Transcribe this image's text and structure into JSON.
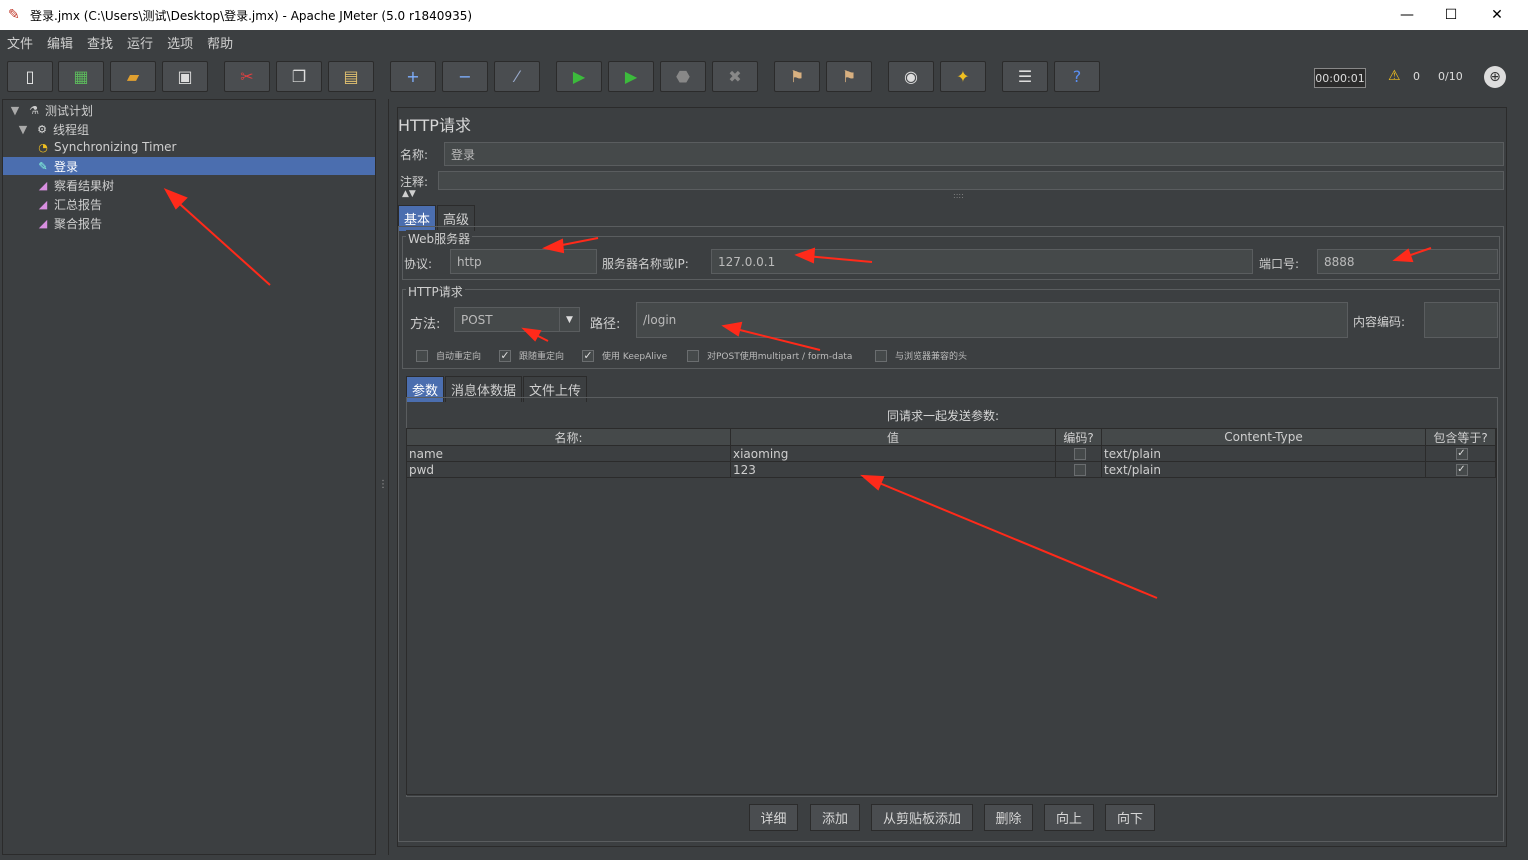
{
  "window": {
    "title": "登录.jmx (C:\\Users\\测试\\Desktop\\登录.jmx) - Apache JMeter (5.0 r1840935)",
    "minimize": "—",
    "maximize": "☐",
    "close": "✕"
  },
  "menu": [
    "文件",
    "编辑",
    "查找",
    "运行",
    "选项",
    "帮助"
  ],
  "toolbar": {
    "timer": "00:00:01",
    "warn_count": "0",
    "threads": "0/10"
  },
  "tree": [
    {
      "label": "测试计划",
      "icon": "flask-icon"
    },
    {
      "label": "线程组",
      "icon": "gear-icon"
    },
    {
      "label": "Synchronizing Timer",
      "icon": "clock-icon"
    },
    {
      "label": "登录",
      "icon": "pipette-icon",
      "selected": true
    },
    {
      "label": "察看结果树",
      "icon": "graph-icon"
    },
    {
      "label": "汇总报告",
      "icon": "graph-icon"
    },
    {
      "label": "聚合报告",
      "icon": "graph-icon"
    }
  ],
  "panel": {
    "title": "HTTP请求",
    "name_label": "名称:",
    "name_value": "登录",
    "comment_label": "注释:",
    "tabs": [
      "基本",
      "高级"
    ],
    "web_server_title": "Web服务器",
    "protocol_label": "协议:",
    "protocol_value": "http",
    "server_label": "服务器名称或IP:",
    "server_value": "127.0.0.1",
    "port_label": "端口号:",
    "port_value": "8888",
    "http_request_title": "HTTP请求",
    "method_label": "方法:",
    "method_value": "POST",
    "path_label": "路径:",
    "path_value": "/login",
    "encoding_label": "内容编码:",
    "checkboxes": [
      {
        "label": "自动重定向",
        "checked": false
      },
      {
        "label": "跟随重定向",
        "checked": true
      },
      {
        "label": "使用 KeepAlive",
        "checked": true
      },
      {
        "label": "对POST使用multipart / form-data",
        "checked": false
      },
      {
        "label": "与浏览器兼容的头",
        "checked": false
      }
    ],
    "sub_tabs": [
      "参数",
      "消息体数据",
      "文件上传"
    ],
    "params_caption": "同请求一起发送参数:",
    "columns": [
      "名称:",
      "值",
      "编码?",
      "Content-Type",
      "包含等于?"
    ],
    "rows": [
      {
        "name": "name",
        "value": "xiaoming",
        "encode": false,
        "content_type": "text/plain",
        "include_equals": true
      },
      {
        "name": "pwd",
        "value": "123",
        "encode": false,
        "content_type": "text/plain",
        "include_equals": true
      }
    ],
    "buttons": [
      "详细",
      "添加",
      "从剪贴板添加",
      "删除",
      "向上",
      "向下"
    ]
  },
  "colors": {
    "background": "#3c3f41",
    "selection": "#4b6eaf",
    "annotation_arrow": "#ff2a1a"
  }
}
